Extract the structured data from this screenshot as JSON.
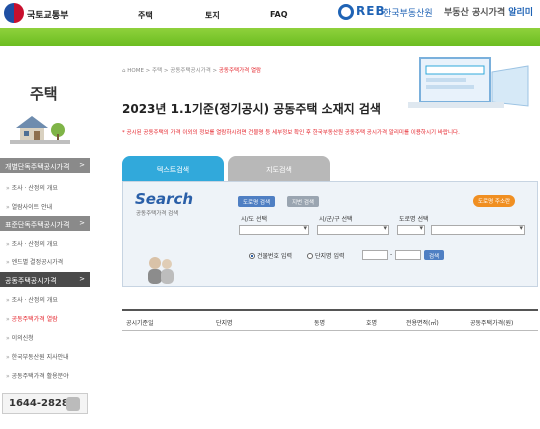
{
  "header": {
    "gov_name": "국토교통부",
    "nav": [
      "주택",
      "토지",
      "FAQ"
    ],
    "reb_logo": "REB",
    "reb_korean": "한국부동산원",
    "service_prefix": "부동산 공시가격",
    "service_highlight": "알리미"
  },
  "sidebar": {
    "title": "주택",
    "menu": [
      {
        "label": "개별단독주택공시가격",
        "sub": [
          "조사 · 산정의 개요",
          "열람사이트 안내"
        ]
      },
      {
        "label": "표준단독주택공시가격",
        "sub": [
          "조사 · 산정의 개요",
          "엔드별 결정공시가격"
        ]
      },
      {
        "label": "공동주택공시가격",
        "sub": [
          "조사 · 산정의 개요",
          "공동주택가격 열람",
          "이의신청",
          "한국부동산원 지사안내",
          "공동주택가격 활용분야"
        ]
      }
    ],
    "phone": "1644-2828"
  },
  "breadcrumb": {
    "items": [
      "HOME",
      "주택",
      "공동주택공시가격"
    ],
    "current": "공동주택가격 열람"
  },
  "page_title": "2023년 1.1기준(정기공시) 공동주택 소재지 검색",
  "notice": "* 공시된 공동주택의 가격 이외의 정보를 열람하시려면 건물명 등 세부정보 확인 후 한국부동산원 공동주택 공시가격 알리미를 이용하시기 바랍니다.",
  "tabs": [
    "텍스트검색",
    "지도검색"
  ],
  "search": {
    "title": "Search",
    "subtitle": "공동주택가격 검색",
    "road_btn": "도로명 검색",
    "jibun_btn": "지번 검색",
    "help_btn": "도로명 주소란",
    "labels": [
      "시/도 선택",
      "시/군/구 선택",
      "도로명 선택"
    ],
    "radio_1": "건물번호 입력",
    "radio_2": "단지명 입력",
    "go_btn": "검색"
  },
  "table": {
    "headers": [
      "공시기준일",
      "단지명",
      "동명",
      "호명",
      "전용면적(㎡)",
      "공동주택가격(원)"
    ]
  },
  "colors": {
    "green": "#6cbd21",
    "blue": "#31a9db",
    "red": "#e5242c"
  }
}
